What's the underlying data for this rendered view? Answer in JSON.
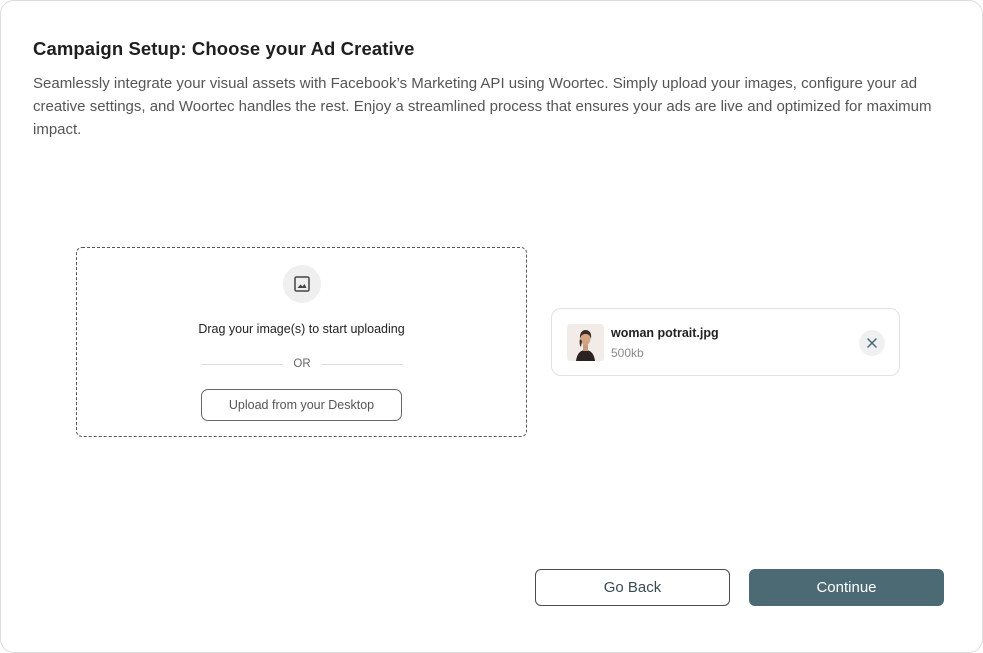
{
  "header": {
    "title": "Campaign Setup: Choose your Ad Creative",
    "description": "Seamlessly integrate your visual assets with Facebook’s Marketing API using Woortec. Simply upload your images, configure your ad creative settings, and Woortec handles the rest. Enjoy a streamlined process that ensures your ads are live and optimized for maximum impact."
  },
  "upload": {
    "icon": "image-icon",
    "drag_text": "Drag your image(s) to start uploading",
    "divider_text": "OR",
    "button_label": "Upload from your Desktop"
  },
  "file": {
    "icon": "image-thumbnail",
    "name": "woman potrait.jpg",
    "size": "500kb",
    "remove_icon": "close-icon"
  },
  "actions": {
    "back_label": "Go Back",
    "continue_label": "Continue"
  },
  "colors": {
    "primary": "#4c6a74",
    "border": "#dcdcdc"
  }
}
